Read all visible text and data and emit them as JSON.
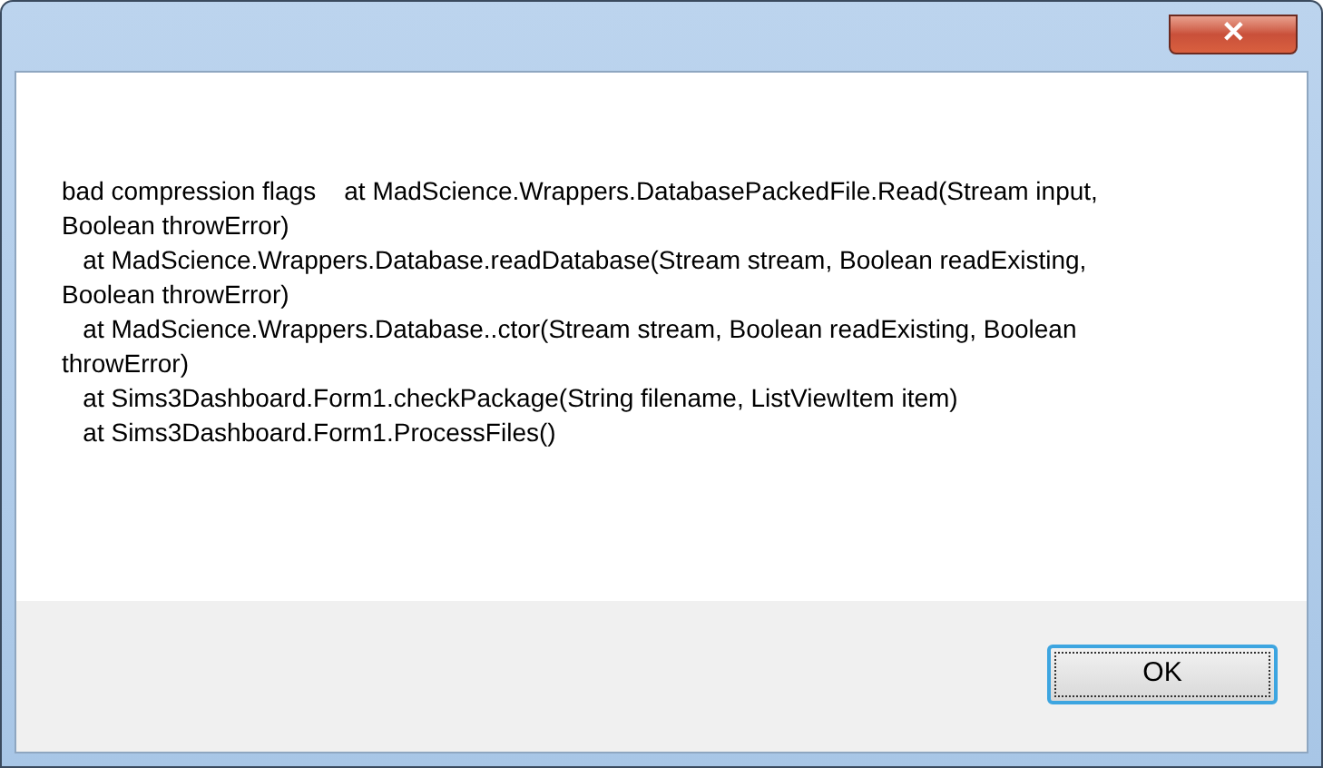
{
  "window": {
    "close_glyph": "✕"
  },
  "message": "bad compression flags    at MadScience.Wrappers.DatabasePackedFile.Read(Stream input, Boolean throwError)\n   at MadScience.Wrappers.Database.readDatabase(Stream stream, Boolean readExisting, Boolean throwError)\n   at MadScience.Wrappers.Database..ctor(Stream stream, Boolean readExisting, Boolean throwError)\n   at Sims3Dashboard.Form1.checkPackage(String filename, ListViewItem item)\n   at Sims3Dashboard.Form1.ProcessFiles()",
  "buttons": [
    {
      "label": "OK",
      "focused": true
    }
  ]
}
